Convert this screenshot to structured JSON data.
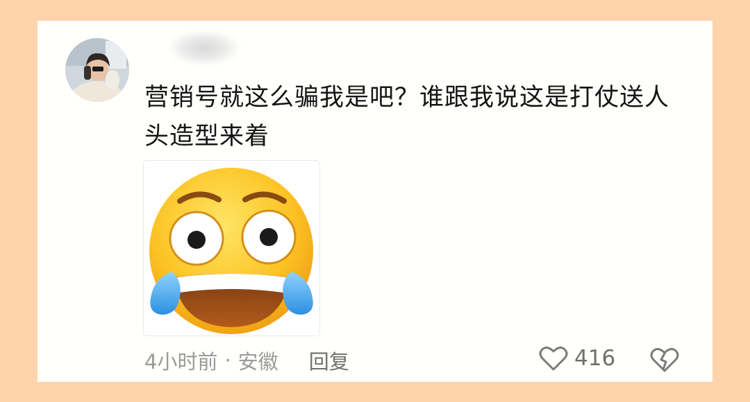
{
  "comment": {
    "text": "营销号就这么骗我是吧？谁跟我说这是打仗送人头造型来着",
    "time": "4小时前",
    "separator": "·",
    "location": "安徽",
    "reply_label": "回复",
    "like_count": "416"
  },
  "icons": {
    "like": "heart-outline-icon",
    "dislike": "broken-heart-icon",
    "sticker": "crying-laughing-face-sticker"
  },
  "colors": {
    "background": "#fcd3aa",
    "card": "#fffffc",
    "text": "#141414",
    "meta": "#9a9a9a"
  }
}
